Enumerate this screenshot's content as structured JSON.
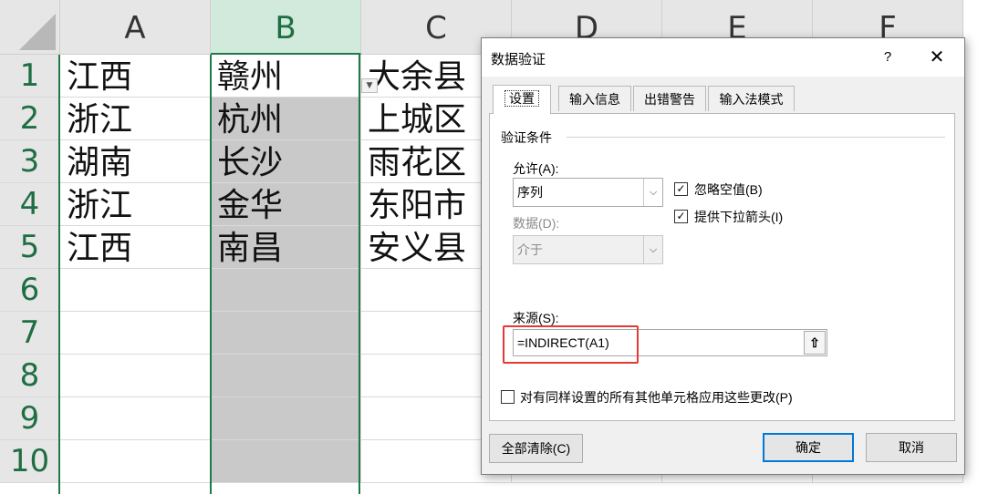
{
  "spreadsheet": {
    "columns": [
      "A",
      "B",
      "C",
      "D",
      "E",
      "F"
    ],
    "selected_column": "B",
    "rows": [
      "1",
      "2",
      "3",
      "4",
      "5",
      "6",
      "7",
      "8",
      "9",
      "10"
    ],
    "cells": {
      "A": [
        "江西",
        "浙江",
        "湖南",
        "浙江",
        "江西",
        "",
        "",
        "",
        "",
        ""
      ],
      "B": [
        "赣州",
        "杭州",
        "长沙",
        "金华",
        "南昌",
        "",
        "",
        "",
        "",
        ""
      ],
      "C": [
        "大余县",
        "上城区",
        "雨花区",
        "东阳市",
        "安义县",
        "",
        "",
        "",
        "",
        ""
      ]
    }
  },
  "dialog": {
    "title": "数据验证",
    "help_label": "?",
    "close_label": "✕",
    "tabs": [
      "设置",
      "输入信息",
      "出错警告",
      "输入法模式"
    ],
    "active_tab": "设置",
    "criteria_title": "验证条件",
    "allow_label": "允许(A):",
    "allow_value": "序列",
    "data_label": "数据(D):",
    "data_value": "介于",
    "ignore_blank_label": "忽略空值(B)",
    "ignore_blank_checked": true,
    "in_cell_dropdown_label": "提供下拉箭头(I)",
    "in_cell_dropdown_checked": true,
    "source_label": "来源(S):",
    "source_value": "=INDIRECT(A1)",
    "apply_all_label": "对有同样设置的所有其他单元格应用这些更改(P)",
    "apply_all_checked": false,
    "clear_all_label": "全部清除(C)",
    "ok_label": "确定",
    "cancel_label": "取消"
  }
}
